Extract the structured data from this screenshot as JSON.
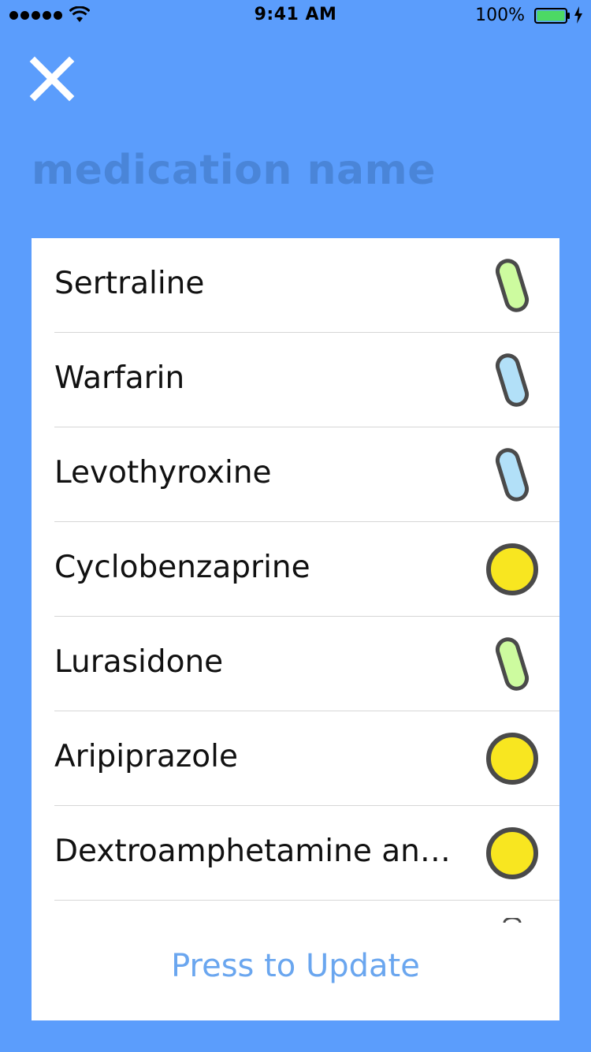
{
  "status_bar": {
    "time": "9:41 AM",
    "battery_percent": "100%",
    "signal_bars": 5,
    "icons": [
      "wifi-icon",
      "battery-icon",
      "charging-icon"
    ]
  },
  "header": {
    "close_icon": "close-icon",
    "title": "medication name"
  },
  "medications": [
    {
      "name": "Sertraline",
      "pill": "capsule",
      "color": "#cdfb9f"
    },
    {
      "name": "Warfarin",
      "pill": "capsule",
      "color": "#b2e0f8"
    },
    {
      "name": "Levothyroxine",
      "pill": "capsule",
      "color": "#b2e0f8"
    },
    {
      "name": "Cyclobenzaprine",
      "pill": "round",
      "color": "#f8e620"
    },
    {
      "name": "Lurasidone",
      "pill": "capsule",
      "color": "#cdfb9f"
    },
    {
      "name": "Aripiprazole",
      "pill": "round",
      "color": "#f8e620"
    },
    {
      "name": "Dextroamphetamine an…",
      "pill": "round",
      "color": "#f8e620"
    }
  ],
  "update_button": {
    "label": "Press to Update"
  },
  "colors": {
    "background": "#5b9dfc",
    "title": "#4a85d8",
    "pill_outline": "#4a4a4a",
    "update_text": "#6aa6ef"
  }
}
